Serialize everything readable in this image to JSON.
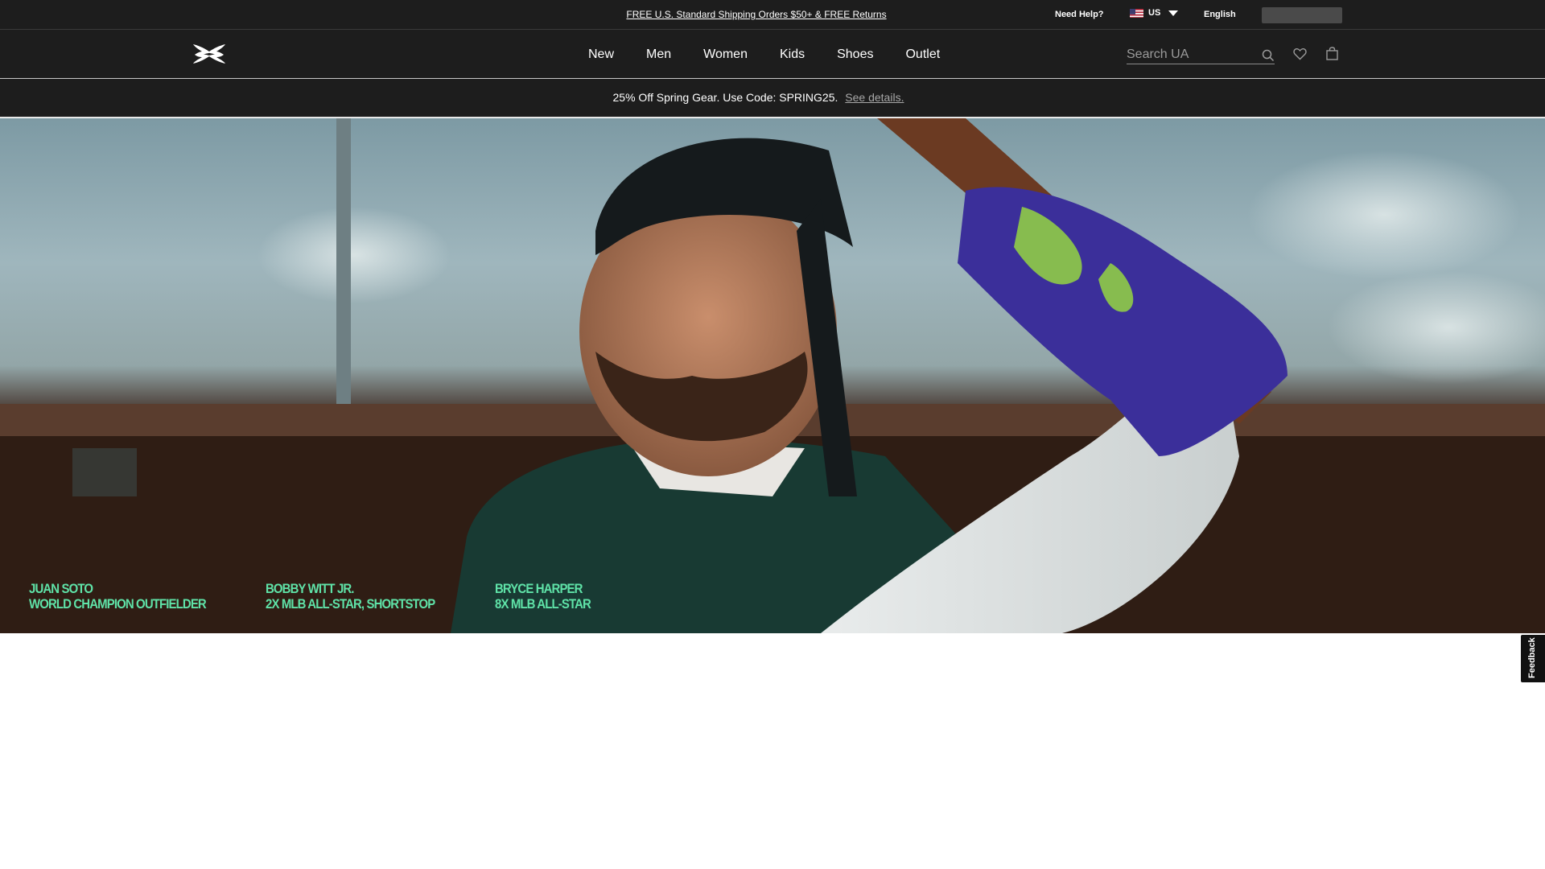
{
  "utility_bar": {
    "shipping_text": "FREE U.S. Standard Shipping Orders $50+ & FREE Returns",
    "need_help": "Need Help?",
    "country": "US",
    "language": "English"
  },
  "header": {
    "nav": [
      "New",
      "Men",
      "Women",
      "Kids",
      "Shoes",
      "Outlet"
    ],
    "search_placeholder": "Search UA"
  },
  "promo": {
    "text": "25% Off Spring Gear. Use Code: SPRING25.",
    "link": "See details."
  },
  "hero": {
    "captions": [
      {
        "name": "JUAN SOTO",
        "title": "WORLD CHAMPION OUTFIELDER"
      },
      {
        "name": "BOBBY WITT JR.",
        "title": "2X MLB ALL-STAR, SHORTSTOP"
      },
      {
        "name": "BRYCE HARPER",
        "title": "8X MLB ALL-STAR"
      }
    ]
  },
  "feedback": "Feedback",
  "colors": {
    "header_bg": "#1d1d1d",
    "caption": "#5fe3a8",
    "glove": "#3b2f9a"
  },
  "icons": [
    "ua-logo",
    "us-flag-icon",
    "chevron-down-icon",
    "search-icon",
    "heart-icon",
    "bag-icon"
  ]
}
